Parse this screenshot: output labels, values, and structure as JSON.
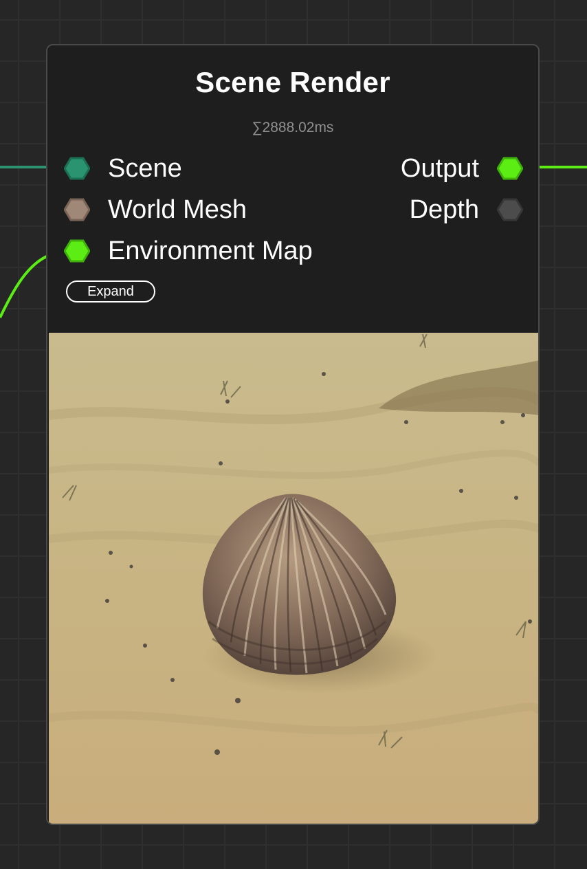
{
  "node": {
    "title": "Scene Render",
    "timing": "∑2888.02ms",
    "expand_label": "Expand"
  },
  "inputs": [
    {
      "label": "Scene",
      "color": "#2a9470"
    },
    {
      "label": "World Mesh",
      "color": "#a08878"
    },
    {
      "label": "Environment Map",
      "color": "#5cee14"
    }
  ],
  "outputs": [
    {
      "label": "Output",
      "color": "#5cee14"
    },
    {
      "label": "Depth",
      "color": "#4c4c4c"
    }
  ],
  "wires": {
    "scene_wire_color": "#2a9470",
    "env_wire_color": "#5cee14",
    "output_wire_color": "#5cee14"
  },
  "canvas": {
    "background": "#262626",
    "grid_line": "#2f2f2f"
  }
}
